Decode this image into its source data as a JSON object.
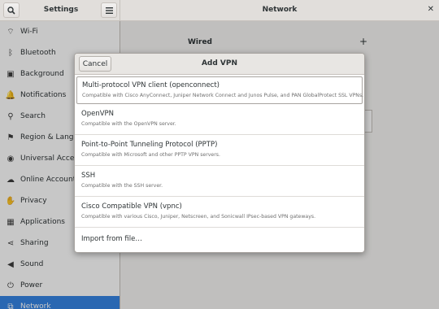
{
  "headerbar": {
    "left_title": "Settings",
    "main_title": "Network",
    "close_glyph": "✕",
    "search_icon": "search-icon",
    "menu_icon": "hamburger-menu-icon"
  },
  "sidebar": {
    "items": [
      {
        "label": "Wi-Fi",
        "icon": "wifi-icon",
        "glyph": "⌔"
      },
      {
        "label": "Bluetooth",
        "icon": "bluetooth-icon",
        "glyph": "ᛒ"
      },
      {
        "label": "Background",
        "icon": "background-icon",
        "glyph": "▣"
      },
      {
        "label": "Notifications",
        "icon": "bell-icon",
        "glyph": "🔔"
      },
      {
        "label": "Search",
        "icon": "search-icon",
        "glyph": "⚲"
      },
      {
        "label": "Region & Language",
        "icon": "flag-icon",
        "glyph": "⚑"
      },
      {
        "label": "Universal Access",
        "icon": "accessibility-icon",
        "glyph": "◉"
      },
      {
        "label": "Online Accounts",
        "icon": "cloud-icon",
        "glyph": "☁"
      },
      {
        "label": "Privacy",
        "icon": "privacy-hand-icon",
        "glyph": "✋"
      },
      {
        "label": "Applications",
        "icon": "applications-icon",
        "glyph": "▦"
      },
      {
        "label": "Sharing",
        "icon": "share-icon",
        "glyph": "⋖"
      },
      {
        "label": "Sound",
        "icon": "speaker-icon",
        "glyph": "◀"
      },
      {
        "label": "Power",
        "icon": "power-icon",
        "glyph": "⏻"
      },
      {
        "label": "Network",
        "icon": "network-icon",
        "glyph": "⧉",
        "active": true
      }
    ]
  },
  "main": {
    "wired_label": "Wired",
    "add_glyph": "+"
  },
  "dialog": {
    "cancel_label": "Cancel",
    "title": "Add VPN",
    "vpn_options": [
      {
        "name": "Multi-protocol VPN client (openconnect)",
        "description": "Compatible with Cisco AnyConnect, Juniper Network Connect and Junos Pulse, and PAN GlobalProtect SSL VPNs."
      },
      {
        "name": "OpenVPN",
        "description": "Compatible with the OpenVPN server."
      },
      {
        "name": "Point-to-Point Tunneling Protocol (PPTP)",
        "description": "Compatible with Microsoft and other PPTP VPN servers."
      },
      {
        "name": "SSH",
        "description": "Compatible with the SSH server."
      },
      {
        "name": "Cisco Compatible VPN (vpnc)",
        "description": "Compatible with various Cisco, Juniper, Netscreen, and Sonicwall IPsec-based VPN gateways."
      }
    ],
    "import_label": "Import from file…"
  },
  "colors": {
    "accent": "#3584e4",
    "headerbar": "#e1dedb",
    "sidebar": "#ffffff"
  }
}
